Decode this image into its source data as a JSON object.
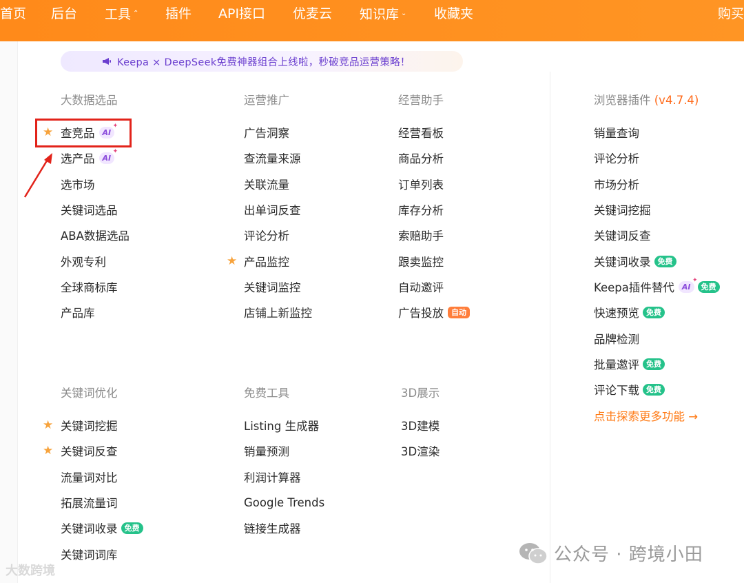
{
  "nav": {
    "items": [
      {
        "label": "首页"
      },
      {
        "label": "后台"
      },
      {
        "label": "工具"
      },
      {
        "label": "插件"
      },
      {
        "label": "API接口"
      },
      {
        "label": "优麦云"
      },
      {
        "label": "知识库"
      },
      {
        "label": "收藏夹"
      },
      {
        "label": "购买"
      }
    ]
  },
  "banner": {
    "text": "Keepa × DeepSeek免费神器组合上线啦，秒破竞品运营策略！"
  },
  "sections": {
    "big_data": {
      "title": "大数据选品",
      "items": [
        "查竞品",
        "选产品",
        "选市场",
        "关键词选品",
        "ABA数据选品",
        "外观专利",
        "全球商标库",
        "产品库"
      ]
    },
    "ops": {
      "title": "运营推广",
      "items": [
        "广告洞察",
        "查流量来源",
        "关联流量",
        "出单词反查",
        "评论分析",
        "产品监控",
        "关键词监控",
        "店铺上新监控"
      ]
    },
    "biz": {
      "title": "经营助手",
      "items": [
        "经营看板",
        "商品分析",
        "订单列表",
        "库存分析",
        "索赔助手",
        "跟卖监控",
        "自动邀评",
        "广告投放"
      ]
    },
    "plugin": {
      "title": "浏览器插件",
      "version": "(v4.7.4)",
      "items": [
        "销量查询",
        "评论分析",
        "市场分析",
        "关键词挖掘",
        "关键词反查",
        "关键词收录",
        "Keepa插件替代",
        "快速预览",
        "品牌检测",
        "批量邀评",
        "评论下载"
      ],
      "more": "点击探索更多功能 →"
    },
    "keyword": {
      "title": "关键词优化",
      "items": [
        "关键词挖掘",
        "关键词反查",
        "流量词对比",
        "拓展流量词",
        "关键词收录",
        "关键词词库"
      ]
    },
    "free": {
      "title": "免费工具",
      "items": [
        "Listing 生成器",
        "销量预测",
        "利润计算器",
        "Google Trends",
        "链接生成器"
      ]
    },
    "show3d": {
      "title": "3D展示",
      "items": [
        "3D建模",
        "3D渲染"
      ]
    }
  },
  "badges": {
    "ai": "AI",
    "free": "免费",
    "auto": "自动"
  },
  "watermarks": {
    "left": "大数跨境",
    "right": "公众号 · 跨境小田"
  },
  "colors": {
    "nav_bg": "#ff8a1a",
    "accent": "#ff6a1a",
    "free_badge": "#25c28a",
    "ai_badge": "#8b4ddb",
    "highlight": "#e2231a"
  }
}
